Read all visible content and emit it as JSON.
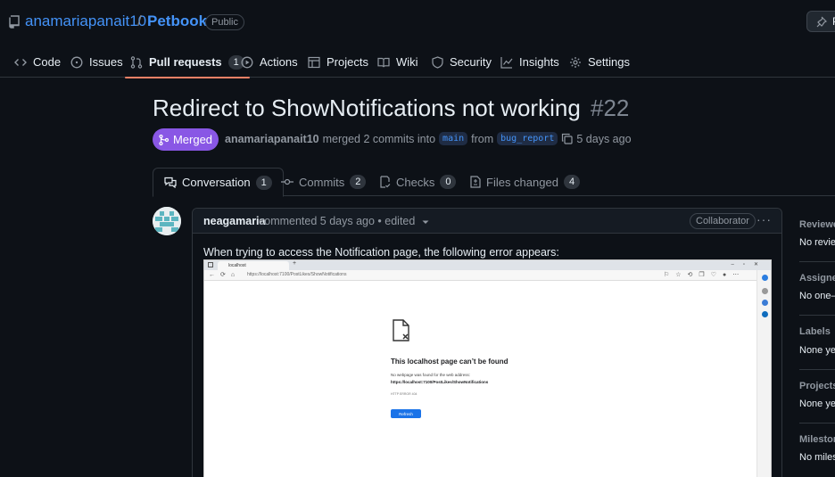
{
  "repo": {
    "owner": "anamariapanait10",
    "separator": "/",
    "name": "Petbook",
    "visibility": "Public",
    "pin_label": "P"
  },
  "nav": {
    "tabs": [
      {
        "label": "Code",
        "icon": "code-icon"
      },
      {
        "label": "Issues",
        "icon": "issue-icon"
      },
      {
        "label": "Pull requests",
        "icon": "pull-request-icon",
        "count": "1",
        "active": true
      },
      {
        "label": "Actions",
        "icon": "play-icon"
      },
      {
        "label": "Projects",
        "icon": "table-icon"
      },
      {
        "label": "Wiki",
        "icon": "book-icon"
      },
      {
        "label": "Security",
        "icon": "shield-icon"
      },
      {
        "label": "Insights",
        "icon": "graph-icon"
      },
      {
        "label": "Settings",
        "icon": "gear-icon"
      }
    ]
  },
  "pr": {
    "title": "Redirect to ShowNotifications not working",
    "number": "#22",
    "state": "Merged",
    "author": "anamariapanait10",
    "merged_text": "merged 2 commits into",
    "base_branch": "main",
    "from_text": "from",
    "head_branch": "bug_report",
    "time": "5 days ago"
  },
  "pr_tabs": [
    {
      "label": "Conversation",
      "count": "1",
      "icon": "comment-discussion-icon",
      "active": true
    },
    {
      "label": "Commits",
      "count": "2",
      "icon": "commit-icon"
    },
    {
      "label": "Checks",
      "count": "0",
      "icon": "checklist-icon"
    },
    {
      "label": "Files changed",
      "count": "4",
      "icon": "file-diff-icon"
    }
  ],
  "comment": {
    "author": "neagamaria",
    "meta": "commented 5 days ago • edited",
    "role": "Collaborator",
    "more": "···",
    "body": "When trying to access the Notification page, the following error appears:",
    "screenshot": {
      "tab_label": "localhost",
      "url": "https://localhost:7100/PostLikes/ShowNotifications",
      "heading": "This localhost page can’t be found",
      "description": "No webpage was found for the web address:",
      "link": "https://localhost:7100/PostLikes/ShowNotifications",
      "error_code": "HTTP ERROR 404",
      "button": "Refresh"
    }
  },
  "sidebar": {
    "sections": [
      {
        "heading": "Reviewers",
        "value": "No reviews"
      },
      {
        "heading": "Assignees",
        "value": "No one—"
      },
      {
        "heading": "Labels",
        "value": "None yet"
      },
      {
        "heading": "Projects",
        "value": "None yet"
      },
      {
        "heading": "Milestone",
        "value": "No milestone"
      }
    ]
  },
  "colors": {
    "background": "#0d1117",
    "link": "#4493f8",
    "merged": "#8957e5",
    "active_tab_underline": "#f78166"
  }
}
